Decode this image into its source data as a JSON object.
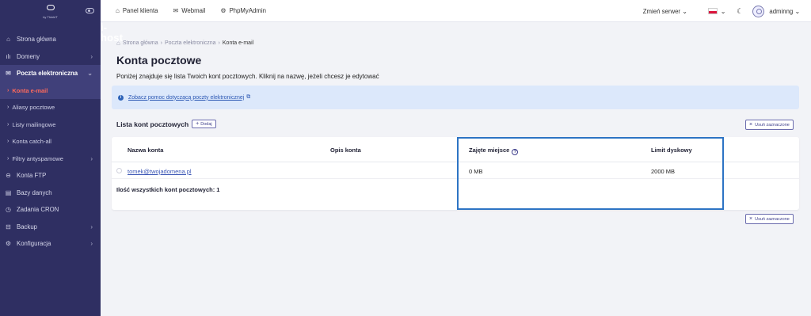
{
  "logo": {
    "main": "i-host",
    "sub": "by ThinkIT"
  },
  "topbar": {
    "links": [
      {
        "icon": "home-icon",
        "label": "Panel klienta"
      },
      {
        "icon": "mail-icon",
        "label": "Webmail"
      },
      {
        "icon": "gear-icon",
        "label": "PhpMyAdmin"
      }
    ],
    "server_switch": "Zmień serwer",
    "user": "adminng"
  },
  "sidebar": {
    "items": [
      {
        "label": "Strona główna"
      },
      {
        "label": "Domeny"
      },
      {
        "label": "Poczta elektroniczna"
      },
      {
        "label": "Konta e-mail"
      },
      {
        "label": "Aliasy pocztowe"
      },
      {
        "label": "Listy mailingowe"
      },
      {
        "label": "Konta catch-all"
      },
      {
        "label": "Filtry antyspamowe"
      },
      {
        "label": "Konta FTP"
      },
      {
        "label": "Bazy danych"
      },
      {
        "label": "Zadania CRON"
      },
      {
        "label": "Backup"
      },
      {
        "label": "Konfiguracja"
      }
    ]
  },
  "breadcrumb": {
    "items": [
      "Strona główna",
      "Poczta elektroniczna",
      "Konta e-mail"
    ]
  },
  "page": {
    "title": "Konta pocztowe",
    "description": "Poniżej znajduje się lista Twoich kont pocztowych. Kliknij na nazwę, jeżeli chcesz je edytować",
    "help_link": "Zobacz pomoc dotyczącą poczty elektronicznej"
  },
  "list": {
    "title": "Lista kont pocztowych",
    "add_label": "Dodaj",
    "remove_label": "Usuń zaznaczone",
    "columns": [
      "Nazwa konta",
      "Opis konta",
      "Zajęte miejsce",
      "Limit dyskowy"
    ],
    "rows": [
      {
        "name": "tomek@twojadomena.pl",
        "description": "",
        "used": "0 MB",
        "limit": "2000 MB"
      }
    ],
    "total_label": "Ilość wszystkich kont pocztowych: 1"
  },
  "colors": {
    "sidebar_bg": "#2f2f62",
    "active_item": "#ff6a5c",
    "highlight": "#2d74c4",
    "info_bg": "#dce8fb"
  }
}
